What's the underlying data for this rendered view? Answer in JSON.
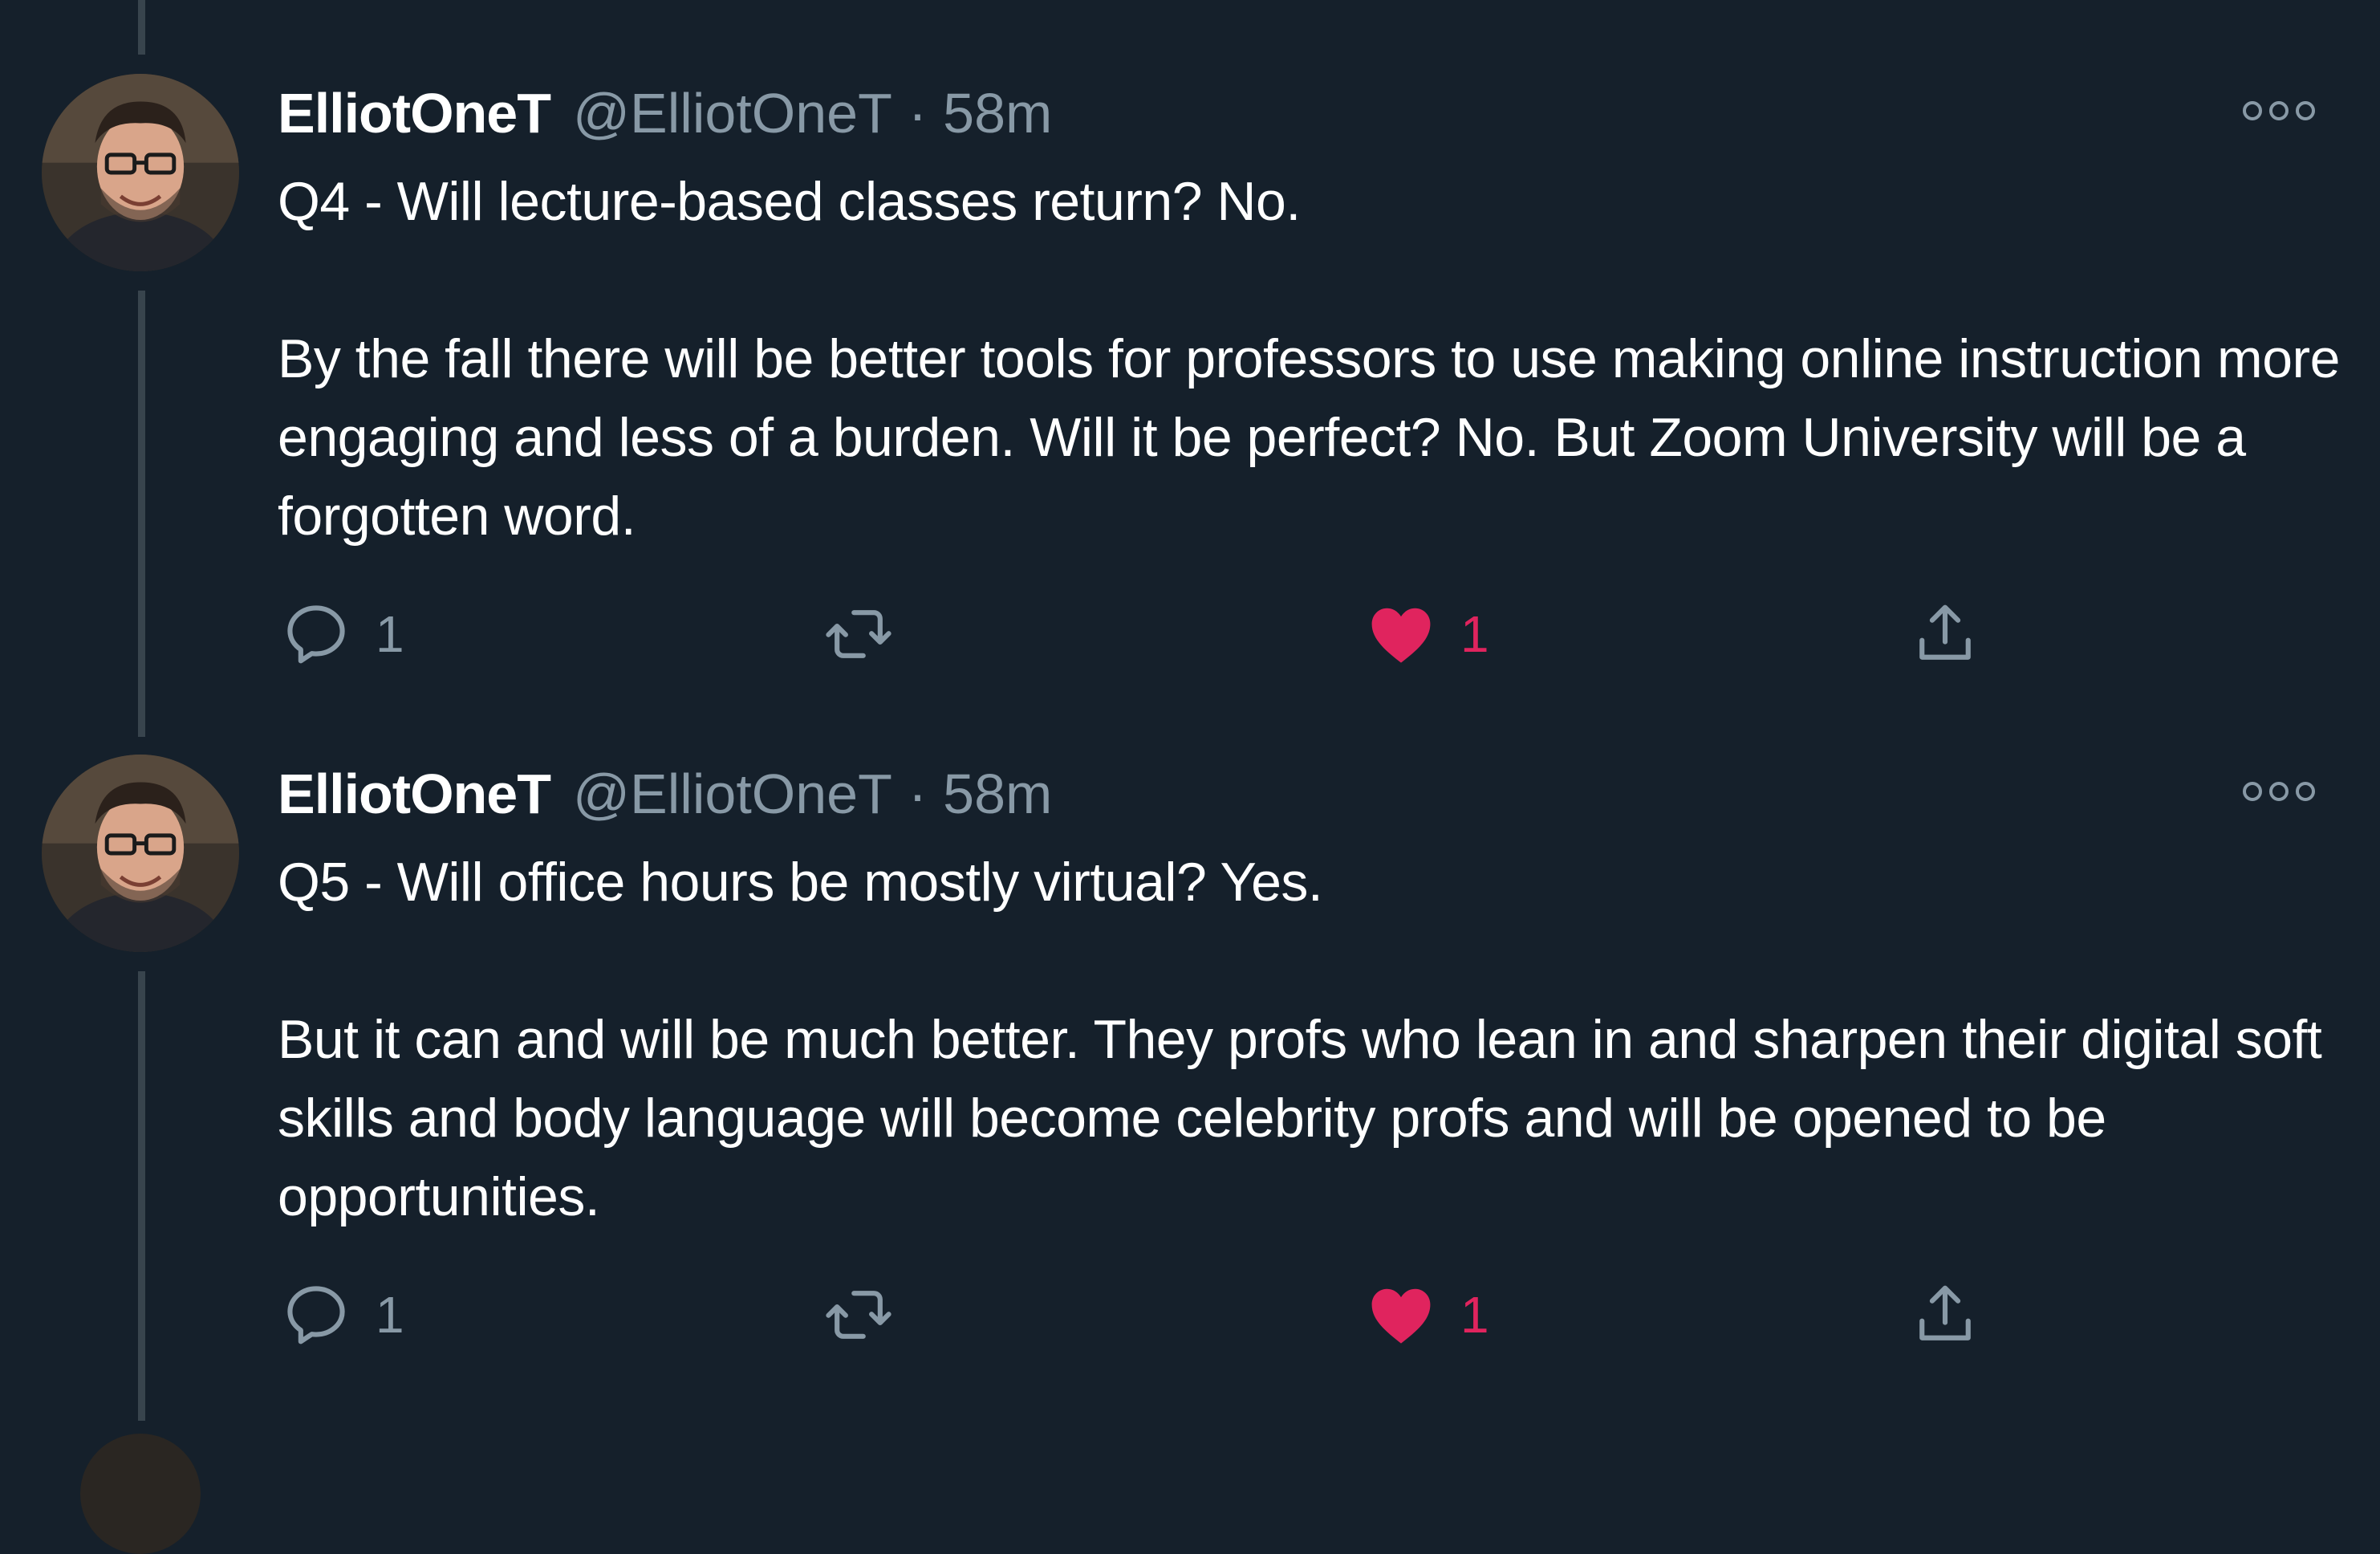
{
  "colors": {
    "background": "#15202b",
    "text_primary": "#ffffff",
    "text_secondary": "#8899a6",
    "like_active": "#e0245e",
    "thread_line": "#38444d"
  },
  "tweets": [
    {
      "display_name": "ElliotOneT",
      "handle": "@ElliotOneT",
      "separator": "·",
      "time": "58m",
      "paragraphs": [
        "Q4 - Will lecture-based classes return? No.",
        "By the fall there will be better tools for professors to use making online instruction more engaging and less of a burden. Will it be perfect? No. But Zoom University will be a forgotten word."
      ],
      "reply_count": "1",
      "like_count": "1",
      "liked": true,
      "icons": {
        "reply": "reply-icon",
        "retweet": "retweet-icon",
        "like": "heart-icon",
        "share": "share-icon",
        "more": "more-options-icon"
      }
    },
    {
      "display_name": "ElliotOneT",
      "handle": "@ElliotOneT",
      "separator": "·",
      "time": "58m",
      "paragraphs": [
        "Q5 - Will office hours be mostly virtual? Yes.",
        "But it can and will be much better. They profs who lean in and sharpen their digital soft skills and body language will become celebrity profs and will be opened to be opportunities."
      ],
      "reply_count": "1",
      "like_count": "1",
      "liked": true,
      "icons": {
        "reply": "reply-icon",
        "retweet": "retweet-icon",
        "like": "heart-icon",
        "share": "share-icon",
        "more": "more-options-icon"
      }
    }
  ]
}
